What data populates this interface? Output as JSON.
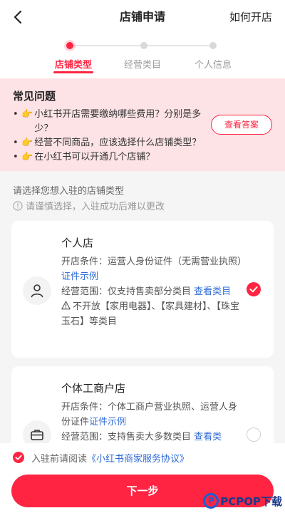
{
  "header": {
    "title": "店铺申请",
    "help": "如何开店"
  },
  "steps": [
    {
      "label": "店铺类型"
    },
    {
      "label": "经营类目"
    },
    {
      "label": "个人信息"
    }
  ],
  "faq": {
    "title": "常见问题",
    "items": [
      "小红书开店需要缴纳哪些费用？分别是多少？",
      "经营不同商品，应该选择什么店铺类型？",
      "在小红书可以开通几个店铺？"
    ],
    "button": "查看答案"
  },
  "section": {
    "title": "请选择您想入驻的店铺类型",
    "warning": "请谨慎选择，入驻成功后难以更改"
  },
  "cards": [
    {
      "name": "个人店",
      "condition_prefix": "开店条件：运营人身份证件（无需营业执照）",
      "condition_link": "证件示例",
      "scope_prefix": "经营范围：仅支持售卖部分类目 ",
      "scope_link": "查看类目",
      "restriction": "不开放【家用电器】、【家具建材】、【珠宝玉石】等类目",
      "selected": true
    },
    {
      "name": "个体工商户店",
      "condition_prefix": "开店条件：个体工商户营业执照、运营人身份证件",
      "condition_link": "证件示例",
      "scope_prefix": "经营范围：支持售卖大多数类目 ",
      "scope_link": "查看类",
      "selected": false
    }
  ],
  "agreement": {
    "prefix": "入驻前请阅读",
    "link": "《小红书商家服务协议》"
  },
  "footer": {
    "next": "下一步"
  },
  "watermark": {
    "letter": "P",
    "text": "PCPOP下载"
  },
  "colors": {
    "accent": "#ff2442",
    "link": "#2e6bd6",
    "faq_bg": "#fde3e6"
  }
}
